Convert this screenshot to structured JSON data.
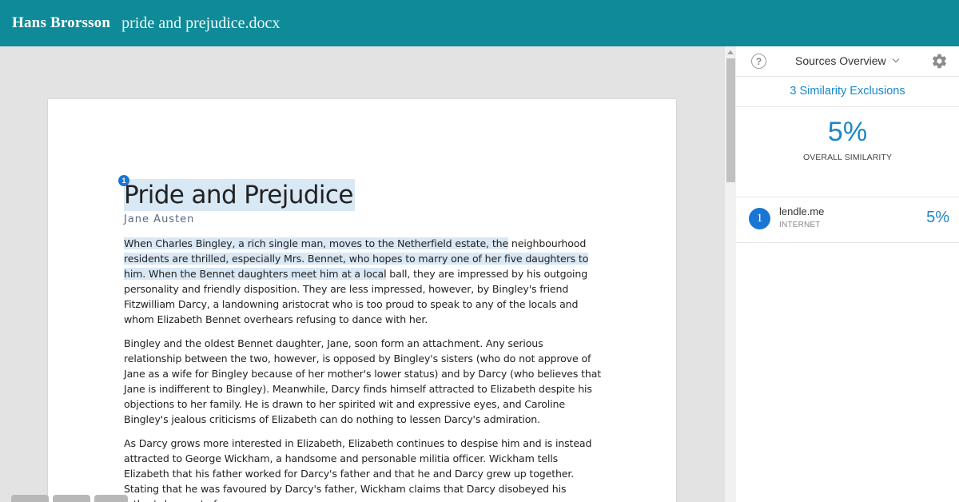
{
  "header": {
    "author": "Hans Brorsson",
    "filename": "pride and prejudice.docx"
  },
  "document": {
    "match_number": "1",
    "title": "Pride and Prejudice",
    "author": "Jane Austen",
    "paragraphs": {
      "p1_hl1": "When Charles Bingley, a rich single man, moves to the Netherfield estate, the",
      "p1_n1": " neighbourhood ",
      "p1_hl2": "residents are thrilled, especially Mrs. Bennet, who hopes to marry one of her five daughters to him. When the Bennet daughters meet him at a local",
      "p1_rest": " ball, they are impressed by his outgoing personality and friendly disposition. They are less impressed, however, by Bingley's friend Fitzwilliam Darcy, a landowning aristocrat who is too proud to speak to any of the locals and whom Elizabeth Bennet overhears refusing to dance with her.",
      "p2": "Bingley and the oldest Bennet daughter, Jane, soon form an attachment. Any serious relationship between the two, however, is opposed by Bingley's sisters (who do not approve of Jane as a wife for Bingley because of her mother's lower status) and by Darcy (who believes that Jane is indifferent to Bingley). Meanwhile, Darcy finds himself attracted to Elizabeth despite his objections to her family. He is drawn to her spirited wit and expressive eyes, and Caroline Bingley's jealous criticisms of Elizabeth can do nothing to lessen Darcy's admiration.",
      "p3": "As Darcy grows more interested in Elizabeth, Elizabeth continues to despise him and is instead attracted to George Wickham, a handsome and personable militia officer. Wickham tells Elizabeth that his father worked for Darcy's father and that he and Darcy grew up together. Stating that he was favoured by Darcy's father, Wickham claims that Darcy disobeyed his father's bequest of a"
    }
  },
  "sidebar": {
    "help_icon": "?",
    "sources_overview_label": "Sources Overview",
    "exclusions_label": "3 Similarity Exclusions",
    "overall_percent": "5%",
    "overall_label": "OVERALL SIMILARITY",
    "sources": [
      {
        "number": "1",
        "name": "lendle.me",
        "type": "INTERNET",
        "percent": "5%"
      }
    ]
  },
  "colors": {
    "header_bg": "#0e8a98",
    "accent_blue": "#1a87c8",
    "highlight": "#d9e8f5",
    "badge_blue": "#1976d2"
  },
  "icons": [
    "help-icon",
    "chevron-down-icon",
    "gear-icon"
  ]
}
